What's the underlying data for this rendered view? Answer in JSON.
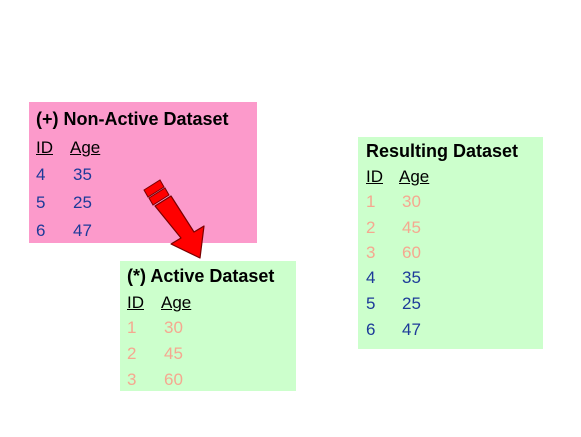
{
  "non_active": {
    "title": "(+) Non-Active Dataset",
    "col_id": "ID",
    "col_age": "Age",
    "rows": [
      {
        "id": "4",
        "age": "35"
      },
      {
        "id": "5",
        "age": "25"
      },
      {
        "id": "6",
        "age": "47"
      }
    ]
  },
  "active": {
    "title": "(*) Active Dataset",
    "col_id": "ID",
    "col_age": "Age",
    "rows": [
      {
        "id": "1",
        "age": "30"
      },
      {
        "id": "2",
        "age": "45"
      },
      {
        "id": "3",
        "age": "60"
      }
    ]
  },
  "result": {
    "title": "Resulting Dataset",
    "col_id": "ID",
    "col_age": "Age",
    "rows": [
      {
        "id": "1",
        "age": "30"
      },
      {
        "id": "2",
        "age": "45"
      },
      {
        "id": "3",
        "age": "60"
      },
      {
        "id": "4",
        "age": "35"
      },
      {
        "id": "5",
        "age": "25"
      },
      {
        "id": "6",
        "age": "47"
      }
    ]
  },
  "colors": {
    "non_active_bg": "#fc9acb",
    "active_bg": "#ccffcc",
    "result_bg": "#ccffcc",
    "non_active_values": "#1c3a99",
    "active_values": "#f5a890",
    "arrow": "#ff0000"
  }
}
